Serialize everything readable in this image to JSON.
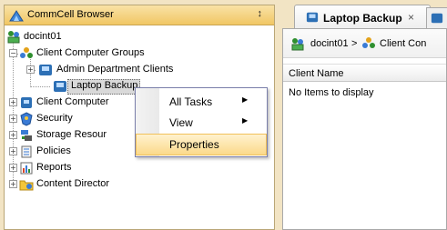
{
  "browser_pane": {
    "title": "CommCell Browser",
    "pin_glyph": "↕",
    "title_icon": "commcell-icon"
  },
  "tree": {
    "root": {
      "label": "docint01",
      "icon": "commserve-icon"
    },
    "items": [
      {
        "label": "Client Computer Groups",
        "icon": "client-groups-icon",
        "expander": "−"
      },
      {
        "label": "Admin Department Clients",
        "icon": "client-group-icon",
        "expander": "+"
      },
      {
        "label": "Laptop Backup",
        "icon": "client-group-icon"
      },
      {
        "label": "Client Computer",
        "icon": "client-computer-icon",
        "expander": "+"
      },
      {
        "label": "Security",
        "icon": "security-icon",
        "expander": "+"
      },
      {
        "label": "Storage Resour",
        "icon": "storage-icon",
        "expander": "+"
      },
      {
        "label": "Policies",
        "icon": "policies-icon",
        "expander": "+"
      },
      {
        "label": "Reports",
        "icon": "reports-icon",
        "expander": "+"
      },
      {
        "label": "Content Director",
        "icon": "content-director-icon",
        "expander": "+"
      }
    ]
  },
  "context_menu": {
    "items": [
      {
        "label": "All Tasks",
        "submenu_arrow": "▶"
      },
      {
        "label": "View",
        "submenu_arrow": "▶"
      },
      {
        "label": "Properties"
      }
    ]
  },
  "tab": {
    "title": "Laptop Backup",
    "close": "×"
  },
  "breadcrumb": {
    "root": "docint01",
    "separator": ">",
    "current": "Client Con"
  },
  "table": {
    "column": "Client Name",
    "empty_text": "No Items to display"
  },
  "colors": {
    "header_gold": "#f1c764",
    "menu_highlight": "#fbd98a",
    "selection_gray": "#d9d9d9"
  }
}
